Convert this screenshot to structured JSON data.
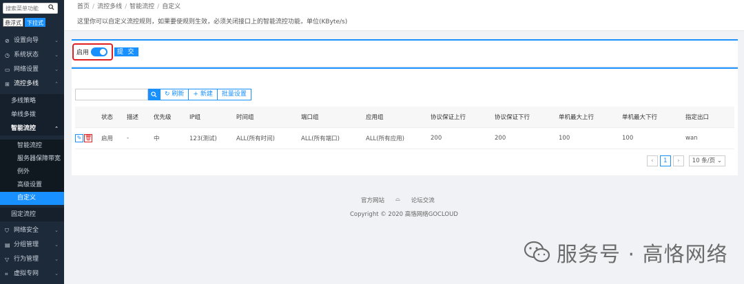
{
  "sidebar": {
    "search_placeholder": "搜索菜单功能",
    "mode_float": "悬浮式",
    "mode_dropdown": "下拉式",
    "items": [
      {
        "label": "设置向导",
        "icon": "compass-icon"
      },
      {
        "label": "系统状态",
        "icon": "clock-icon"
      },
      {
        "label": "网络设置",
        "icon": "monitor-icon"
      },
      {
        "label": "流控多线",
        "icon": "network-icon"
      }
    ],
    "flow_sub": [
      "多线策略",
      "单线多拨",
      "智能流控"
    ],
    "smart_sub": [
      "智能流控",
      "服务器保障带宽",
      "例外",
      "高级设置",
      "自定义"
    ],
    "fixed_flow": "固定流控",
    "bottom_items": [
      {
        "label": "网络安全",
        "icon": "shield-icon"
      },
      {
        "label": "分组管理",
        "icon": "doc-icon"
      },
      {
        "label": "行为管理",
        "icon": "funnel-icon"
      },
      {
        "label": "虚拟专网",
        "icon": "vpn-icon"
      }
    ]
  },
  "breadcrumb": [
    "首页",
    "流控多线",
    "智能流控",
    "自定义"
  ],
  "description": "这里你可以自定义流控规则，如果要使规则生效，必须关闭接口上的智能流控功能，单位(KByte/s)",
  "enable": {
    "label": "启用",
    "on": true,
    "submit": "提 交"
  },
  "toolbar": {
    "refresh": "刷新",
    "add": "新建",
    "batch": "批量设置"
  },
  "table": {
    "headers": [
      "",
      "状态",
      "描述",
      "优先级",
      "IP组",
      "时间组",
      "端口组",
      "应用组",
      "协议保证上行",
      "协议保证下行",
      "单机最大上行",
      "单机最大下行",
      "指定出口"
    ],
    "rows": [
      [
        "",
        "启用",
        "-",
        "中",
        "123(测试)",
        "ALL(所有时间)",
        "ALL(所有端口)",
        "ALL(所有应用)",
        "200",
        "200",
        "100",
        "100",
        "wan"
      ]
    ]
  },
  "pager": {
    "current": "1",
    "size": "10 条/页"
  },
  "footer": {
    "link1": "官方网站",
    "link2": "论坛交流",
    "copyright": "Copyright © 2020 高恪网络GOCLOUD"
  },
  "watermark": "服务号 · 高恪网络",
  "colors": {
    "accent": "#1890ff",
    "sidebar": "#1d2a3a",
    "danger": "#e02020"
  }
}
